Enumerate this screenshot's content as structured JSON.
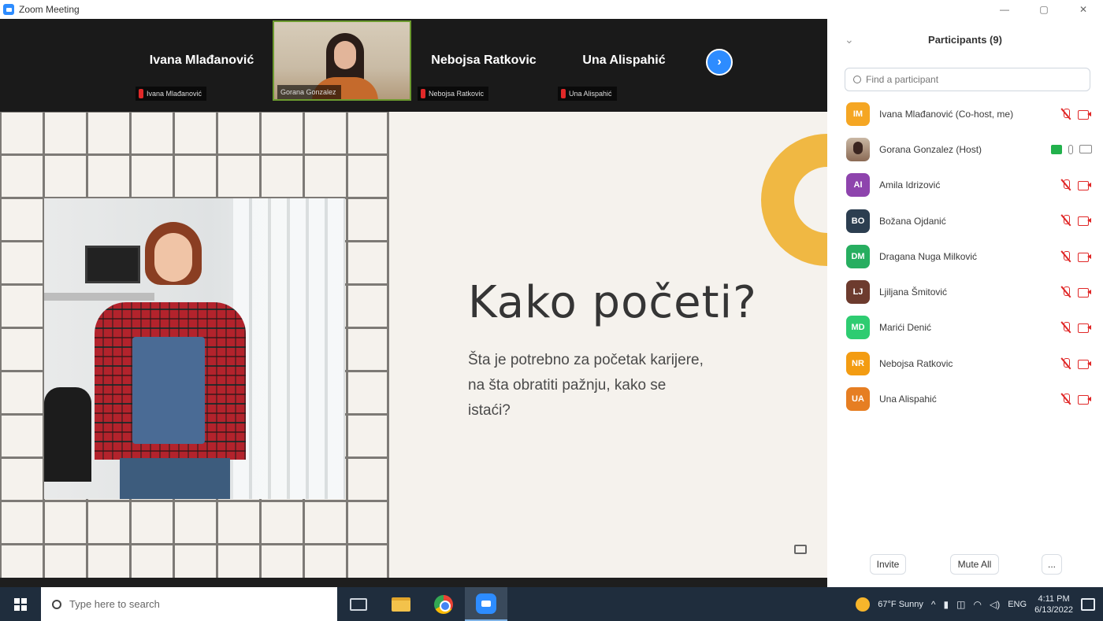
{
  "window": {
    "title": "Zoom Meeting"
  },
  "video_strip": {
    "tiles": [
      {
        "name": "Ivana Mlađanović",
        "tag": "Ivana Mlađanović"
      },
      {
        "name": "",
        "tag": "Gorana Gonzalez"
      },
      {
        "name": "Nebojsa Ratkovic",
        "tag": "Nebojsa Ratkovic"
      },
      {
        "name": "Una Alispahić",
        "tag": "Una Alispahić"
      }
    ],
    "next_label": "›"
  },
  "slide": {
    "title": "Kako početi?",
    "body": "Šta je potrebno za početak karijere, na šta obratiti pažnju, kako se istaći?",
    "accent_color": "#f0b843"
  },
  "panel": {
    "title": "Participants (9)",
    "search_placeholder": "Find a participant",
    "participants": [
      {
        "initials": "IM",
        "name": "Ivana Mlađanović (Co-host, me)",
        "color": "#f5a623",
        "status": "muted"
      },
      {
        "initials": "",
        "name": "Gorana Gonzalez (Host)",
        "color": "photo",
        "status": "host"
      },
      {
        "initials": "AI",
        "name": "Amila Idrizović",
        "color": "#8e44ad",
        "status": "muted"
      },
      {
        "initials": "BO",
        "name": "Božana Ojdanić",
        "color": "#2c3e50",
        "status": "muted"
      },
      {
        "initials": "DM",
        "name": "Dragana Nuga Milković",
        "color": "#27ae60",
        "status": "muted"
      },
      {
        "initials": "LJ",
        "name": "Ljiljana Šmitović",
        "color": "#6d3b2e",
        "status": "muted"
      },
      {
        "initials": "MD",
        "name": "Marići Denić",
        "color": "#2ecc71",
        "status": "muted"
      },
      {
        "initials": "NR",
        "name": "Nebojsa Ratkovic",
        "color": "#f39c12",
        "status": "muted"
      },
      {
        "initials": "UA",
        "name": "Una Alispahić",
        "color": "#e67e22",
        "status": "muted"
      }
    ],
    "footer": {
      "invite": "Invite",
      "mute_all": "Mute All",
      "more": "..."
    }
  },
  "taskbar": {
    "search_placeholder": "Type here to search",
    "weather": "67°F Sunny",
    "lang": "ENG",
    "time": "4:11 PM",
    "date": "6/13/2022"
  }
}
